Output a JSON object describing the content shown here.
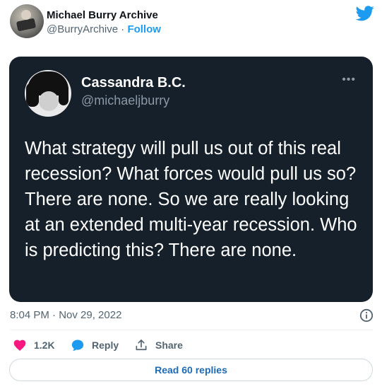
{
  "embed": {
    "author_name": "Michael Burry Archive",
    "author_handle": "@BurryArchive",
    "separator": " · ",
    "follow_label": "Follow"
  },
  "quoted_tweet": {
    "display_name": "Cassandra B.C.",
    "handle": "@michaeljburry",
    "more_label": "•••",
    "text": "What strategy will pull us out of this real recession? What forces would pull us so? There are none. So we are really looking at an extended multi-year recession. Who is predicting this? There are none."
  },
  "meta": {
    "timestamp": "8:04 PM · Nov 29, 2022"
  },
  "actions": {
    "like_count": "1.2K",
    "reply_label": "Reply",
    "share_label": "Share"
  },
  "footer": {
    "read_replies_label": "Read 60 replies"
  },
  "colors": {
    "accent": "#1d9bf0",
    "like": "#f91880",
    "card_bg": "#15202b"
  },
  "icons": [
    "twitter-bird-icon",
    "more-icon",
    "info-icon",
    "heart-icon",
    "reply-bubble-icon",
    "share-icon"
  ]
}
